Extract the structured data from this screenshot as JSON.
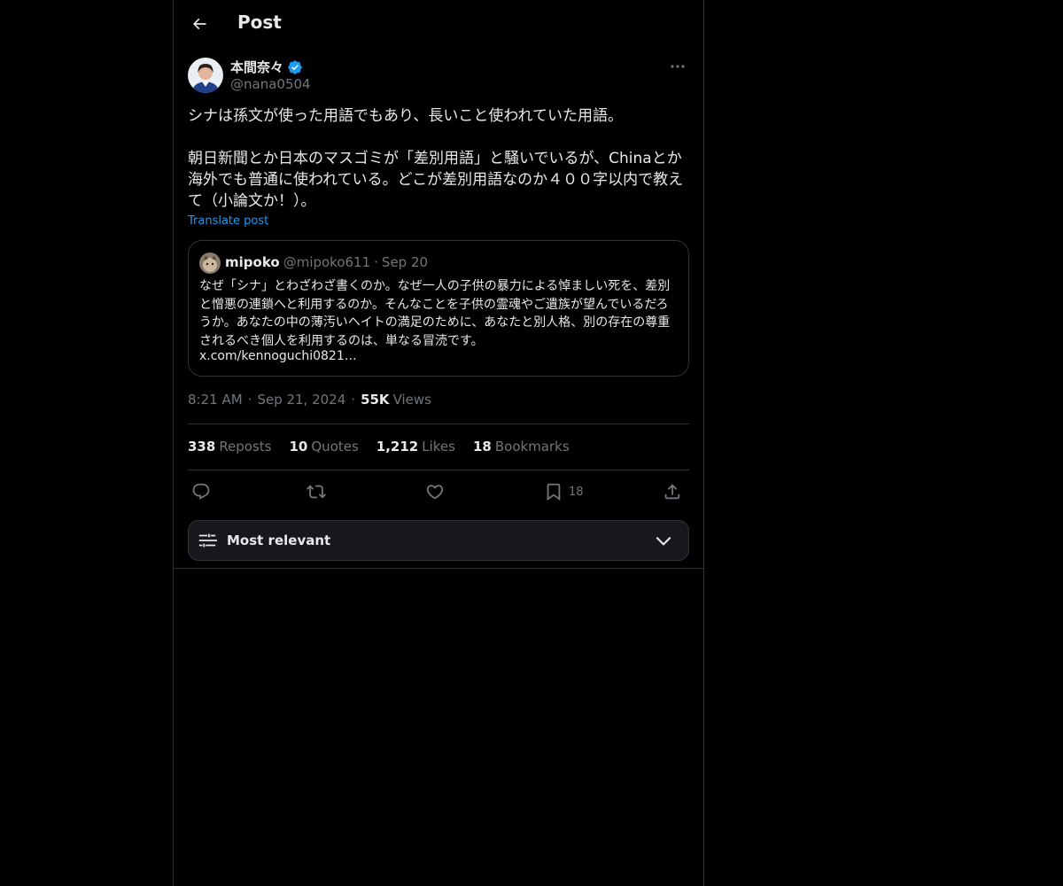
{
  "header": {
    "title": "Post"
  },
  "post": {
    "author_name": "本間奈々",
    "author_handle": "@nana0504",
    "text": "シナは孫文が使った用語でもあり、長いこと使われていた用語。\n\n朝日新聞とか日本のマスゴミが「差別用語」と騒いでいるが、Chinaとか海外でも普通に使われている。どこが差別用語なのか４００字以内で教えて（小論文か！）。",
    "translate_label": "Translate post",
    "time": "8:21 AM",
    "date": "Sep 21, 2024",
    "views_count": "55K",
    "views_label": "Views"
  },
  "quote": {
    "name": "mipoko",
    "handle": "@mipoko611",
    "dot": "·",
    "date": "Sep 20",
    "text": "なぜ「シナ」とわざわざ書くのか。なぜ一人の子供の暴力による悼ましい死を、差別と憎悪の連鎖へと利用するのか。そんなことを子供の霊魂やご遺族が望んでいるだろうか。あなたの中の薄汚いヘイトの満足のために、あなたと別人格、別の存在の尊重されるべき個人を利用するのは、単なる冒涜です。",
    "link": "x.com/kennoguchi0821…"
  },
  "meta_sep": "·",
  "stats": {
    "reposts_count": "338",
    "reposts_label": "Reposts",
    "quotes_count": "10",
    "quotes_label": "Quotes",
    "likes_count": "1,212",
    "likes_label": "Likes",
    "bookmarks_count": "18",
    "bookmarks_label": "Bookmarks"
  },
  "actions": {
    "bookmark_count": "18"
  },
  "sort": {
    "label": "Most relevant"
  },
  "colors": {
    "background": "#000000",
    "text": "#e7e9ea",
    "muted": "#71767b",
    "accent": "#1d9bf0",
    "border": "#2f3336"
  },
  "icons": [
    "arrow-left-icon",
    "verified-badge-icon",
    "more-icon",
    "reply-icon",
    "repost-icon",
    "like-icon",
    "bookmark-icon",
    "share-icon",
    "sliders-icon",
    "chevron-down-icon"
  ]
}
